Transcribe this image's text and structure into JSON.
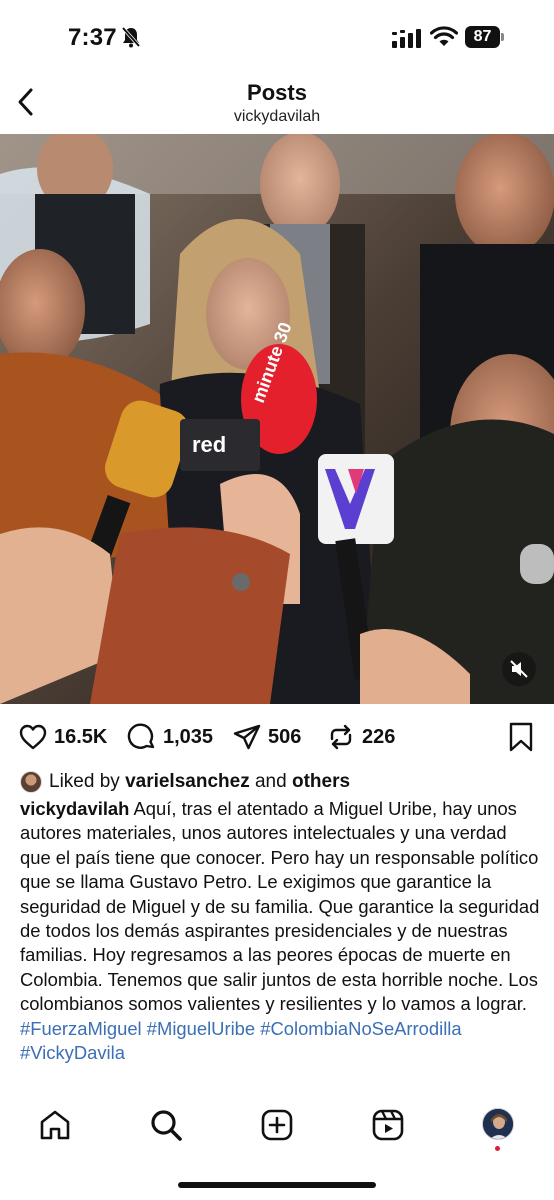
{
  "status_bar": {
    "time": "7:37",
    "battery": "87"
  },
  "header": {
    "title": "Posts",
    "username": "vickydavilah"
  },
  "media": {
    "mic_labels": [
      "minute 30",
      "red"
    ],
    "mute_icon": "speaker-muted-icon"
  },
  "actions": {
    "likes": "16.5K",
    "comments": "1,035",
    "shares": "506",
    "reposts": "226"
  },
  "liked_by": {
    "prefix": "Liked by",
    "user": "varielsanchez",
    "connector": "and",
    "others": "others"
  },
  "caption": {
    "username": "vickydavilah",
    "text": "Aquí, tras el atentado a Miguel Uribe, hay unos autores materiales, unos autores intelectuales y una verdad que  el país tiene que conocer. Pero hay un responsable político que se llama Gustavo Petro. Le exigimos que garantice la seguridad de Miguel y de su familia. Que garantice la seguridad de todos los demás aspirantes presidenciales y de nuestras familias. Hoy regresamos a las peores épocas de muerte en Colombia. Tenemos que salir juntos de esta horrible noche. Los colombianos somos valientes y resilientes y lo vamos a lograr.",
    "hashtags": [
      "#FuerzaMiguel",
      "#MiguelUribe",
      "#ColombiaNoSeArrodilla",
      "#VickyDavila"
    ]
  },
  "nav": {
    "items": [
      "home-icon",
      "search-icon",
      "create-icon",
      "reels-icon",
      "profile-avatar"
    ]
  },
  "colors": {
    "hashtag": "#3b6fb6",
    "notification": "#e01b3c"
  }
}
